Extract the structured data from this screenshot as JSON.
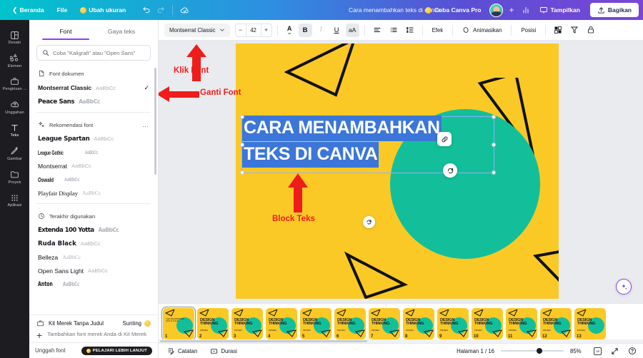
{
  "topbar": {
    "back_label": "Beranda",
    "file_label": "File",
    "resize_label": "Ubah ukuran",
    "undo_icon": "undo-icon",
    "redo_icon": "redo-icon",
    "cloud_icon": "cloud-sync-icon",
    "doc_title": "Cara menambahkan teks di canva",
    "pro_label": "Coba Canva Pro",
    "plus_label": "+",
    "insights_icon": "insights-icon",
    "present_label": "Tampilkan",
    "share_label": "Bagikan"
  },
  "rail": {
    "items": [
      {
        "label": "Desain",
        "icon": "design-icon"
      },
      {
        "label": "Elemen",
        "icon": "elements-icon"
      },
      {
        "label": "Pengkisan ...",
        "icon": "brandkit-icon"
      },
      {
        "label": "Unggahan",
        "icon": "uploads-icon"
      },
      {
        "label": "Teks",
        "icon": "text-icon"
      },
      {
        "label": "Gambar",
        "icon": "draw-icon"
      },
      {
        "label": "Proyek",
        "icon": "projects-icon"
      },
      {
        "label": "Aplikasi",
        "icon": "apps-icon"
      }
    ]
  },
  "panel": {
    "tabs": [
      {
        "label": "Font",
        "active": true
      },
      {
        "label": "Gaya teks",
        "active": false
      }
    ],
    "search_placeholder": "Coba \"Kaligrafi\" atau \"Open Sans\"",
    "search_value": "",
    "sections": [
      {
        "title": "Font dokumen",
        "icon": "document-icon",
        "fonts": [
          {
            "name": "Montserrat Classic",
            "sample": "AaBbCc",
            "checked": true,
            "style": "f-montserrat-classic"
          },
          {
            "name": "Peace Sans",
            "sample": "AaBbCc",
            "checked": false,
            "style": "f-peace"
          }
        ]
      },
      {
        "title": "Rekomendasi font",
        "icon": "sparkle-icon",
        "menu": "…",
        "fonts": [
          {
            "name": "League Spartan",
            "sample": "AaBbCc",
            "checked": false,
            "style": "f-league-spartan"
          },
          {
            "name": "League Gothic",
            "sample": "AaBbCc",
            "checked": false,
            "style": "f-league-gothic"
          },
          {
            "name": "Montserrat",
            "sample": "AaBbCc",
            "checked": false,
            "style": "f-montserrat"
          },
          {
            "name": "Oswald",
            "sample": "AaBbCc",
            "checked": false,
            "style": "f-oswald"
          },
          {
            "name": "Playfair Display",
            "sample": "AaBbCc",
            "checked": false,
            "style": "f-playfair"
          }
        ]
      },
      {
        "title": "Terakhir digunakan",
        "icon": "clock-icon",
        "fonts": [
          {
            "name": "Extenda 100 Yotta",
            "sample": "AaBbCc",
            "checked": false,
            "style": "f-extenda"
          },
          {
            "name": "Ruda Black",
            "sample": "AaBbCc",
            "checked": false,
            "style": "f-ruda"
          },
          {
            "name": "Belleza",
            "sample": "AaBbCc",
            "checked": false,
            "style": "f-belleza"
          },
          {
            "name": "Open Sans Light",
            "sample": "AaBbCc",
            "checked": false,
            "style": "f-opensans-light"
          },
          {
            "name": "Anton",
            "sample": "AaBbCc",
            "checked": false,
            "style": "f-anton"
          }
        ]
      }
    ],
    "brandkit": {
      "title": "Kit Merek Tanpa Judul",
      "edit_label": "Sunting",
      "add_label": "Tambahkan font merek Anda di Kit Merek"
    },
    "footer": {
      "upload_label": "Unggah font",
      "learn_label": "PELAJARI LEBIH LANJUT"
    }
  },
  "toolbar": {
    "font_name": "Montserrat Classic",
    "minus": "−",
    "font_size": "42",
    "plus": "+",
    "color_icon": "text-color-icon",
    "bold": "B",
    "italic": "I",
    "underline": "U",
    "case": "aA",
    "align_icon": "align-left-icon",
    "list_icon": "bullet-list-icon",
    "spacing_icon": "line-spacing-icon",
    "effects_label": "Efek",
    "animate_label": "Animasikan",
    "position_label": "Posisi",
    "transparency_icon": "transparency-icon",
    "copy_style_icon": "copy-style-icon",
    "lock_icon": "lock-icon"
  },
  "canvas": {
    "text_line_1": "CARA MENAMBAHKAN",
    "text_line_2": "TEKS DI CANVA",
    "bg_color": "#fbc926",
    "circle_color": "#13bf9a",
    "selection_color": "#3b76d8",
    "link_icon": "link-icon",
    "rotate_icon": "rotate-icon",
    "magic_icon": "magic-sparkle-icon"
  },
  "annotations": [
    {
      "label": "Klik Font",
      "color": "#ef1c1c"
    },
    {
      "label": "Ganti Font",
      "color": "#ef1c1c"
    },
    {
      "label": "Block Teks",
      "color": "#ef1c1c"
    }
  ],
  "filmstrip": {
    "collapse_icon": "chevron-down-icon",
    "thumbs": [
      {
        "num": "1",
        "title": "",
        "subtitle": "",
        "selected": true,
        "kind": "title"
      },
      {
        "num": "2",
        "title": "DESIGN THINKING",
        "subtitle": "PROSES",
        "selected": false,
        "kind": "design"
      },
      {
        "num": "3",
        "title": "DESIGN THINKING",
        "subtitle": "PROSES",
        "selected": false,
        "kind": "design"
      },
      {
        "num": "4",
        "title": "DESIGN THINKING",
        "subtitle": "PROSES",
        "selected": false,
        "kind": "design"
      },
      {
        "num": "5",
        "title": "DESIGN THINKING",
        "subtitle": "PROSES",
        "selected": false,
        "kind": "design"
      },
      {
        "num": "6",
        "title": "DESIGN THINKING",
        "subtitle": "PROSES",
        "selected": false,
        "kind": "design"
      },
      {
        "num": "7",
        "title": "DESIGN THINKING",
        "subtitle": "PROSES",
        "selected": false,
        "kind": "design"
      },
      {
        "num": "8",
        "title": "DESIGN THINKING",
        "subtitle": "PROSES",
        "selected": false,
        "kind": "design"
      },
      {
        "num": "9",
        "title": "DESIGN THINKING",
        "subtitle": "PROSES",
        "selected": false,
        "kind": "design"
      },
      {
        "num": "10",
        "title": "DESIGN THINKING",
        "subtitle": "PROSES",
        "selected": false,
        "kind": "design"
      },
      {
        "num": "11",
        "title": "DESIGN THINKING",
        "subtitle": "PROSES",
        "selected": false,
        "kind": "design"
      },
      {
        "num": "12",
        "title": "DESIGN THINKING",
        "subtitle": "PROSES",
        "selected": false,
        "kind": "design"
      },
      {
        "num": "13",
        "title": "DESIGN THINKING",
        "subtitle": "PROSES",
        "selected": false,
        "kind": "design"
      }
    ]
  },
  "statusbar": {
    "notes_label": "Catatan",
    "duration_label": "Durasi",
    "page_indicator": "Halaman 1 / 16",
    "zoom_value": "85%",
    "grid_icon": "grid-view-icon",
    "fullscreen_icon": "fullscreen-icon",
    "help_icon": "help-icon"
  }
}
